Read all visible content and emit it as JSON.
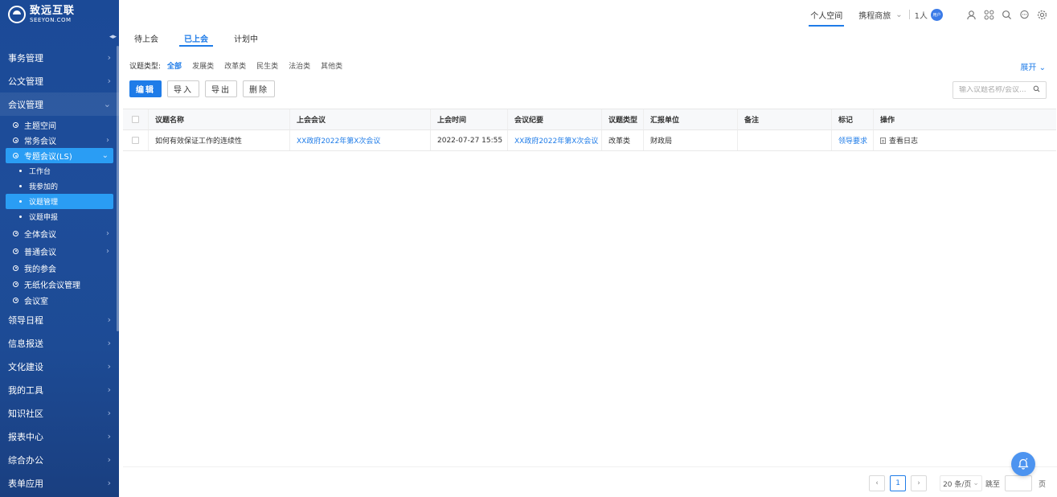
{
  "brand": {
    "name": "致远互联",
    "sub": "SEEYON.COM"
  },
  "sidebar": {
    "items": [
      {
        "label": "事务管理"
      },
      {
        "label": "公文管理"
      },
      {
        "label": "会议管理"
      }
    ],
    "meeting_sub": [
      {
        "label": "主题空间"
      },
      {
        "label": "常务会议"
      },
      {
        "label": "专题会议(LS)"
      }
    ],
    "special_leaf": [
      {
        "label": "工作台"
      },
      {
        "label": "我参加的"
      },
      {
        "label": "议题管理"
      },
      {
        "label": "议题申报"
      }
    ],
    "meeting_sub2": [
      {
        "label": "全体会议"
      },
      {
        "label": "普通会议"
      },
      {
        "label": "我的参会"
      },
      {
        "label": "无纸化会议管理"
      },
      {
        "label": "会议室"
      }
    ],
    "items2": [
      {
        "label": "领导日程"
      },
      {
        "label": "信息报送"
      },
      {
        "label": "文化建设"
      },
      {
        "label": "我的工具"
      },
      {
        "label": "知识社区"
      },
      {
        "label": "报表中心"
      },
      {
        "label": "综合办公"
      },
      {
        "label": "表单应用"
      }
    ]
  },
  "header": {
    "space": "个人空间",
    "travel": "携程商旅",
    "users": "1人",
    "avatar": "用户"
  },
  "tabs": [
    "待上会",
    "已上会",
    "计划中"
  ],
  "filter": {
    "label": "议题类型:",
    "options": [
      "全部",
      "发展类",
      "改革类",
      "民生类",
      "法治类",
      "其他类"
    ],
    "expand": "展开"
  },
  "toolbar": {
    "edit": "编辑",
    "import": "导入",
    "export": "导出",
    "delete": "删除"
  },
  "search": {
    "placeholder": "输入议题名称/会议..."
  },
  "table": {
    "headers": [
      "议题名称",
      "上会会议",
      "上会时间",
      "会议纪要",
      "议题类型",
      "汇报单位",
      "备注",
      "标记",
      "操作"
    ],
    "rows": [
      {
        "name": "如何有效保证工作的连续性",
        "meeting": "XX政府2022年第X次会议",
        "time": "2022-07-27 15:55",
        "minutes": "XX政府2022年第X次会议",
        "type": "改革类",
        "unit": "财政局",
        "remark": "",
        "mark": "领导要求",
        "op": "查看日志"
      }
    ]
  },
  "pager": {
    "current": "1",
    "size": "20 条/页",
    "jump": "跳至",
    "unit": "页"
  }
}
